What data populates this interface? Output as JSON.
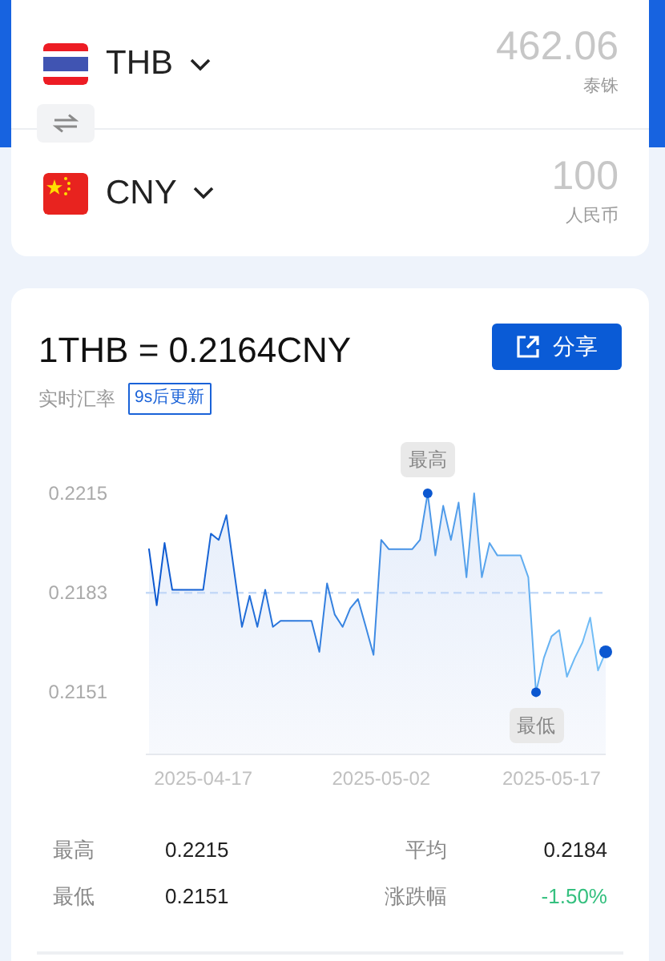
{
  "converter": {
    "rows": [
      {
        "currency": "THB",
        "kind": "th",
        "amount": "462.06",
        "name": "泰铢"
      },
      {
        "currency": "CNY",
        "kind": "cn",
        "amount": "100",
        "name": "人民币"
      }
    ]
  },
  "rate": {
    "title": "1THB = 0.2164CNY",
    "subtitle": "实时汇率",
    "badge": "9s后更新",
    "share_button": "分享"
  },
  "chart": {
    "chart_data": {
      "type": "area",
      "ylim": [
        0.2131,
        0.2215
      ],
      "yticks": [
        0.2151,
        0.2183,
        0.2215
      ],
      "categories": [
        null,
        null,
        null,
        null,
        null,
        null,
        null,
        "2025-04-17",
        null,
        null,
        null,
        null,
        null,
        null,
        null,
        null,
        null,
        null,
        null,
        null,
        null,
        null,
        null,
        null,
        null,
        null,
        null,
        null,
        null,
        null,
        "2025-05-02",
        null,
        null,
        null,
        null,
        null,
        null,
        null,
        null,
        null,
        null,
        null,
        null,
        null,
        null,
        null,
        null,
        null,
        null,
        null,
        null,
        null,
        "2025-05-17",
        null,
        null,
        null,
        null,
        null,
        null,
        null
      ],
      "series": [
        {
          "color": "#0b57d0",
          "values": [
            0.2197,
            0.2179,
            0.2199,
            0.2184,
            0.2184,
            0.2184,
            0.2184,
            0.2184,
            0.2202,
            0.22,
            0.2208,
            0.219,
            0.2172,
            0.2182,
            0.2172,
            0.2184,
            0.2172,
            0.2174,
            0.2174,
            0.2174,
            0.2174,
            0.2174,
            0.2164,
            0.2186,
            0.2176,
            0.2172,
            0.2178,
            0.2181,
            0.2172,
            0.2163,
            0.22,
            0.2197,
            0.2197,
            0.2197,
            0.2197,
            0.22,
            0.2215,
            0.2195,
            0.2211,
            0.22,
            0.2212,
            0.2188,
            0.2215,
            0.2188,
            0.2199,
            0.2195,
            0.2195,
            0.2195,
            0.2195,
            0.2188,
            0.2151,
            0.2162,
            0.2169,
            0.2171,
            0.2156,
            0.2162,
            0.2167,
            0.2175,
            0.2158,
            0.2164
          ]
        }
      ],
      "ref_lines": [
        {
          "axis": "y",
          "value": 0.2183
        }
      ],
      "annotations": [
        {
          "text": "最高",
          "y": 0.2215
        },
        {
          "text": "最低",
          "y": 0.2151
        }
      ]
    }
  },
  "stats": [
    {
      "label": "最高",
      "value": "0.2215"
    },
    {
      "label": "平均",
      "value": "0.2184"
    },
    {
      "label": "最低",
      "value": "0.2151"
    },
    {
      "label": "涨跌幅",
      "value": "-1.50%",
      "color": "#35c07f"
    }
  ]
}
